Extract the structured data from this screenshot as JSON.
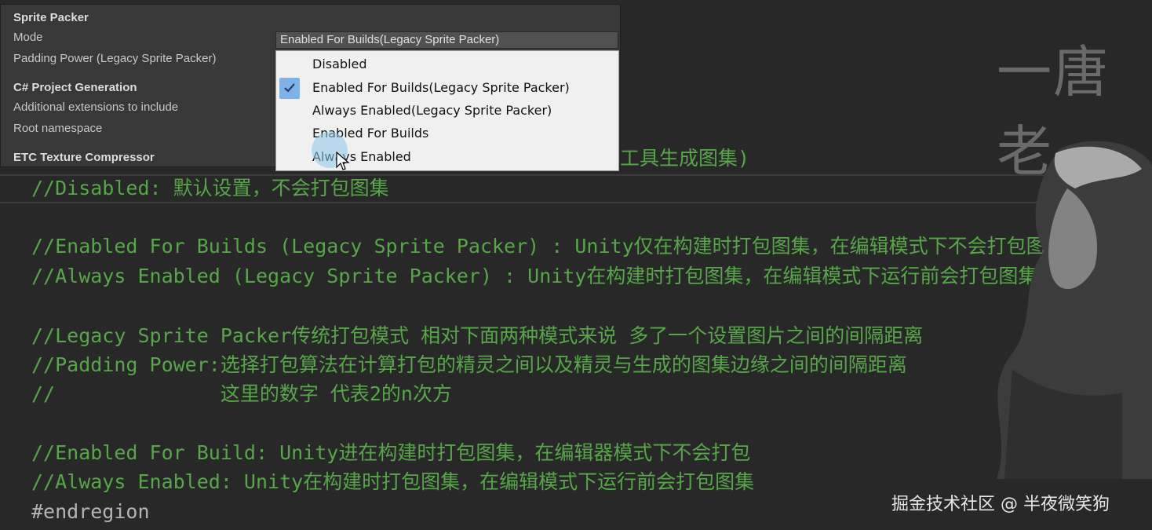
{
  "inspector": {
    "section_sprite_packer": "Sprite Packer",
    "mode_label": "Mode",
    "padding_label": "Padding Power (Legacy Sprite Packer)",
    "section_csharp": "C# Project Generation",
    "extensions_label": "Additional extensions to include",
    "namespace_label": "Root namespace",
    "section_etc": "ETC Texture Compressor",
    "mode_value": "Enabled For Builds(Legacy Sprite Packer)"
  },
  "dropdown": {
    "options": [
      "Disabled",
      "Enabled For Builds(Legacy Sprite Packer)",
      "Always Enabled(Legacy Sprite Packer)",
      "Enabled For Builds",
      "Always Enabled"
    ],
    "selected_index": 1
  },
  "code": {
    "hidden_line_tail": "工具生成图集)",
    "lines": [
      "//Disabled: 默认设置，不会打包图集",
      "//Enabled For Builds (Legacy Sprite Packer) : Unity仅在构建时打包图集，在编辑模式下不会打包图集",
      "//Always Enabled (Legacy Sprite Packer) : Unity在构建时打包图集，在编辑模式下运行前会打包图集",
      "//Legacy Sprite Packer传统打包模式 相对下面两种模式来说 多了一个设置图片之间的间隔距离",
      "//Padding Power:选择打包算法在计算打包的精灵之间以及精灵与生成的图集边缘之间的间隔距离",
      "//              这里的数字 代表2的n次方",
      "//Enabled For Build: Unity进在构建时打包图集，在编辑器模式下不会打包",
      "//Always Enabled: Unity在构建时打包图集，在编辑模式下运行前会打包图集",
      "#endregion"
    ]
  },
  "watermark": {
    "logo": "一唐老",
    "footer": "掘金技术社区 @ 半夜微笑狗"
  },
  "colors": {
    "comment": "#57a64a",
    "editor_bg": "#282828",
    "inspector_bg": "#383838",
    "selected_highlight": "#7fb2e8"
  }
}
